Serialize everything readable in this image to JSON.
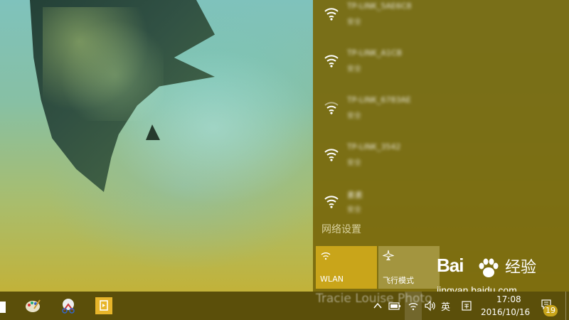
{
  "flyout": {
    "networks": [
      {
        "ssid": "TP-LINK_5AE6C8",
        "status": "安全"
      },
      {
        "ssid": "TP-LINK_A1CB",
        "status": "安全"
      },
      {
        "ssid": "TP-LINK_6783AE",
        "status": "安全"
      },
      {
        "ssid": "TP-LINK_3542",
        "status": "安全"
      },
      {
        "ssid": "素素",
        "status": "安全"
      }
    ],
    "settings_link": "网络设置",
    "tiles": {
      "wlan_label": "WLAN",
      "airplane_label": "飞行模式"
    }
  },
  "watermark": {
    "brand_left": "Bai",
    "brand_right": "经验",
    "url": "jingyan.baidu.com"
  },
  "taskbar": {
    "ghost_text": "Tracie Louise Photo",
    "ime": "英",
    "time": "17:08",
    "date": "2016/10/16",
    "notification_count": "19"
  },
  "colors": {
    "accent": "#c9a51a",
    "flyout_bg": "#7a6c10",
    "taskbar_bg": "#5b4f0a"
  }
}
